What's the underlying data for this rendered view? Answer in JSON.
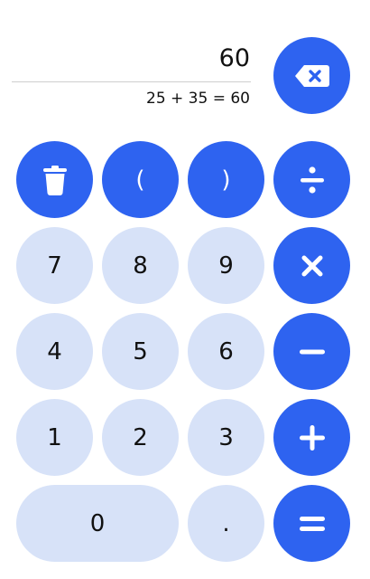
{
  "display": {
    "result": "60",
    "expression": "25 + 35 = 60"
  },
  "colors": {
    "accent": "#2e63f0",
    "key_bg": "#d7e2f8",
    "text": "#111111",
    "divider": "#cfcfcf"
  },
  "keys": {
    "backspace_icon": "backspace-icon",
    "clear_icon": "trash-icon",
    "open_paren": "(",
    "close_paren": ")",
    "divide_icon": "divide-icon",
    "seven": "7",
    "eight": "8",
    "nine": "9",
    "multiply_icon": "multiply-icon",
    "four": "4",
    "five": "5",
    "six": "6",
    "minus_icon": "minus-icon",
    "one": "1",
    "two": "2",
    "three": "3",
    "plus_icon": "plus-icon",
    "zero": "0",
    "decimal": ".",
    "equals_icon": "equals-icon"
  }
}
